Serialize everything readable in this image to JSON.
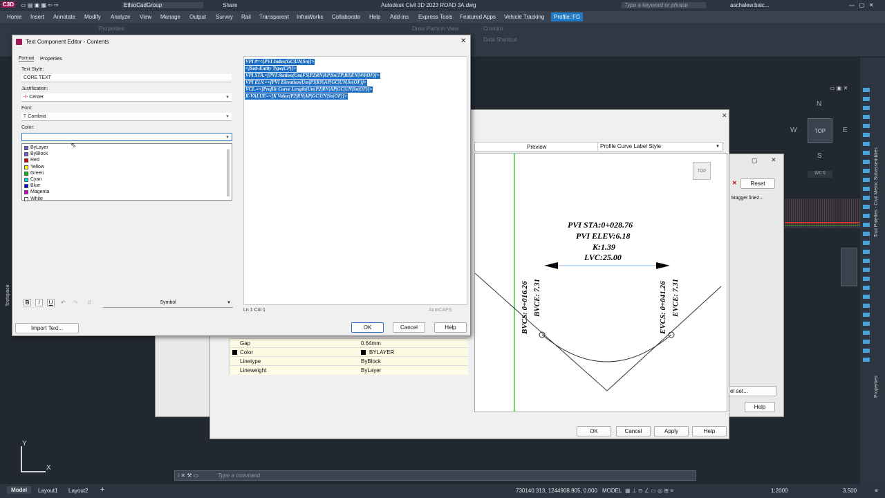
{
  "titlebar": {
    "app_badge": "C3D",
    "workspace": "EthioCadGroup",
    "share": "Share",
    "title": "Autodesk Civil 3D 2023    ROAD 3A.dwg",
    "search_placeholder": "Type a keyword or phrase",
    "user": "aschalew.balc..."
  },
  "menu": [
    "Home",
    "Insert",
    "Annotate",
    "Modify",
    "Analyze",
    "View",
    "Manage",
    "Output",
    "Survey",
    "Rail",
    "Transparent",
    "InfraWorks",
    "Collaborate",
    "Help",
    "Add-ins",
    "Express Tools",
    "Featured Apps",
    "Vehicle Tracking",
    "Profile: FG"
  ],
  "ribbon": {
    "properties": "Properties",
    "draw_parts": "Draw Parts in View",
    "corridor": "Corridor",
    "data_shortcut": "Data Shortcut"
  },
  "dialog": {
    "title": "Text Component Editor - Contents",
    "tabs": [
      "Format",
      "Properties"
    ],
    "text_style_label": "Text Style:",
    "text_style_value": "CORE TEXT",
    "justification_label": "Justification:",
    "justification_value": "Center",
    "font_label": "Font:",
    "font_value": "Cambria",
    "color_label": "Color:",
    "colors": [
      {
        "name": "ByLayer",
        "hex": "#6a5acd"
      },
      {
        "name": "ByBlock",
        "hex": "#6a5acd"
      },
      {
        "name": "Red",
        "hex": "#d40000"
      },
      {
        "name": "Yellow",
        "hex": "#ffff00"
      },
      {
        "name": "Green",
        "hex": "#00c000"
      },
      {
        "name": "Cyan",
        "hex": "#00e0e0"
      },
      {
        "name": "Blue",
        "hex": "#0000d0"
      },
      {
        "name": "Magenta",
        "hex": "#d000d0"
      },
      {
        "name": "White",
        "hex": "#ffffff"
      }
    ],
    "format_buttons": [
      "B",
      "I",
      "U"
    ],
    "symbol_label": "Symbol",
    "import_button": "Import Text...",
    "code_lines": [
      "VPI #=<[PVI Index(GC|UN|Sn)]>",
      "<[Sub-Entity Type(CP)]>",
      "VPI STA.<[PVI Station(Um|FS|P2|RN|AP|Sn|TP|B3|EN|W0|OF)]>",
      "VPI ELV.=<[PVI Elevation(Um|P3|RN|AP|GC|UN|Sn|OF)]>",
      "VCL.=<[Profile Curve Length(Um|P2|RN|AP|GC|UN|Sn|OF)]>",
      "K-VALUE=<[K Value(P2|RN|AP|GC|UN|Sn|OF)]>"
    ],
    "status_pos": "Ln 1 Col 1",
    "status_caps": "AutoCAPS",
    "ok": "OK",
    "cancel": "Cancel",
    "help": "Help"
  },
  "preview": {
    "tab": "Preview",
    "style": "Profile Curve Label Style",
    "top": "TOP",
    "lines": [
      "PVI STA:0+028.76",
      "PVI ELEV:6.18",
      "K:1.39",
      "LVC:25.00"
    ],
    "bvcs": "BVCS: 0+016.26",
    "bvce": "BVCE: 7.31",
    "evcs": "EVCS: 0+041.26",
    "evce": "EVCE: 7.31"
  },
  "props": [
    {
      "name": "Gap",
      "value": "0.64mm"
    },
    {
      "name": "Color",
      "value": "BYLAYER"
    },
    {
      "name": "Linetype",
      "value": "ByBlock"
    },
    {
      "name": "Lineweight",
      "value": "ByLayer"
    }
  ],
  "style_dialog": {
    "ok": "OK",
    "cancel": "Cancel",
    "apply": "Apply",
    "help": "Help"
  },
  "back_dialog": {
    "reset": "Reset",
    "stagger": "Stagger line2...",
    "label_set": "el set...",
    "help": "Help"
  },
  "viewcube": {
    "n": "N",
    "w": "W",
    "e": "E",
    "s": "S",
    "top": "TOP",
    "wcs": "WCS"
  },
  "side": {
    "toolspace": "Toolspace",
    "palettes": "Tool Palettes - Civil Metric Subassemblies",
    "properties": "Properties"
  },
  "ucs": {
    "x": "X",
    "y": "Y"
  },
  "command_placeholder": "Type a command",
  "status": {
    "model_tab": "Model",
    "layouts": [
      "Layout1",
      "Layout2"
    ],
    "coords": "730140.313, 1244908.805, 0.000",
    "model": "MODEL",
    "scale": "1:2000",
    "units": "3.500"
  }
}
